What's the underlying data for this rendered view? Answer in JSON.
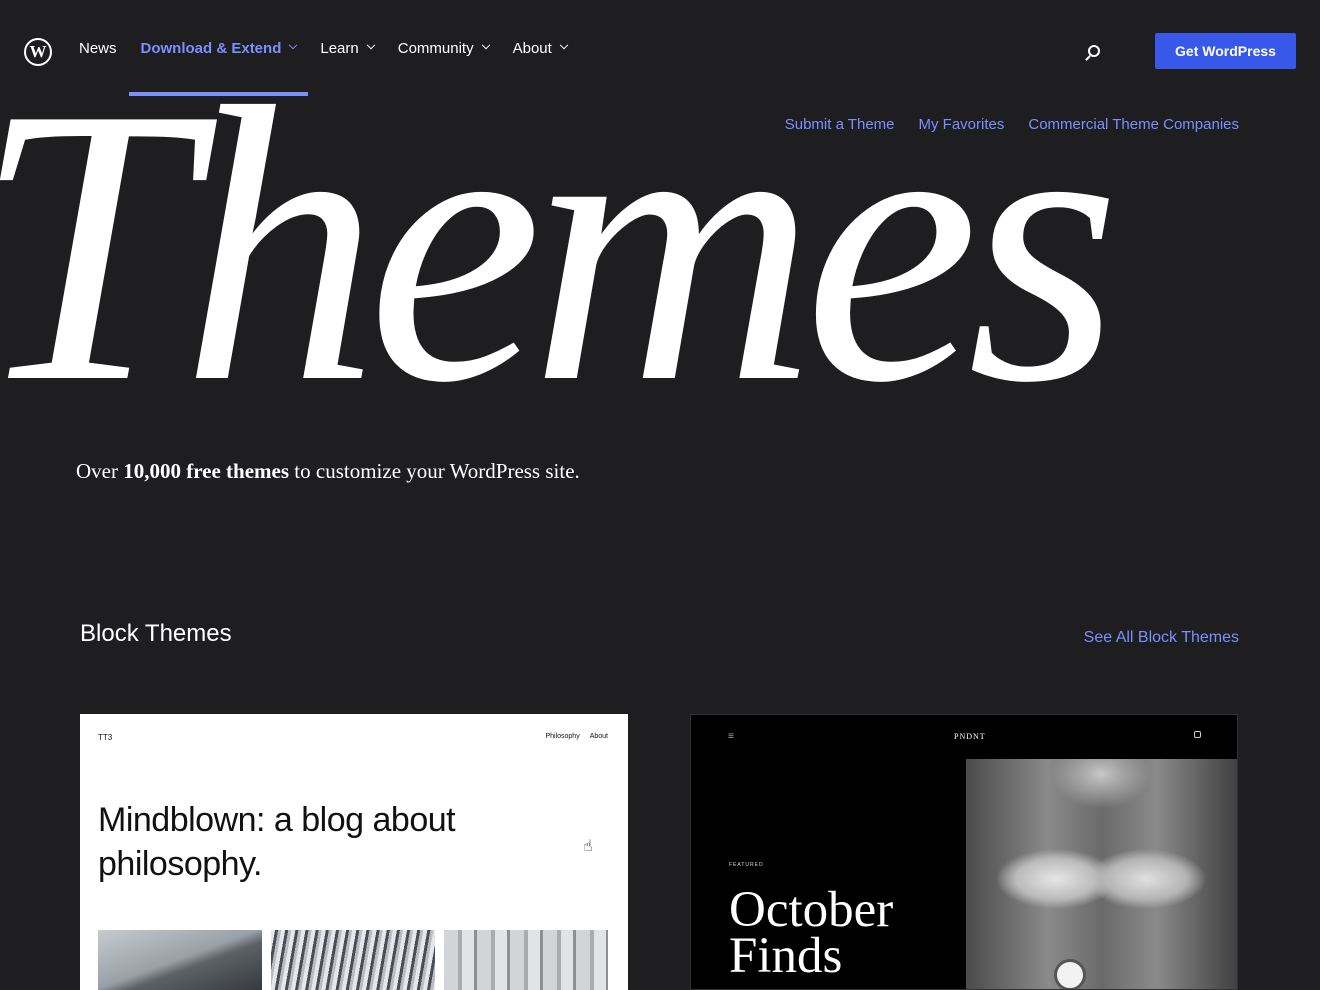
{
  "nav": {
    "logo_letter": "W",
    "items": [
      {
        "label": "News",
        "has_menu": false,
        "active": false
      },
      {
        "label": "Download & Extend",
        "has_menu": true,
        "active": true
      },
      {
        "label": "Learn",
        "has_menu": true,
        "active": false
      },
      {
        "label": "Community",
        "has_menu": true,
        "active": false
      },
      {
        "label": "About",
        "has_menu": true,
        "active": false
      }
    ],
    "cta_label": "Get WordPress",
    "accent_color": "#7b90ff",
    "cta_color": "#3858e9"
  },
  "hero": {
    "word": "Themes",
    "subnav": [
      "Submit a Theme",
      "My Favorites",
      "Commercial Theme Companies"
    ],
    "tagline_prefix": "Over ",
    "tagline_bold": "10,000 free themes",
    "tagline_suffix": " to customize your WordPress site."
  },
  "block_themes": {
    "title": "Block Themes",
    "see_all": "See All Block Themes",
    "cards": [
      {
        "brand": "TT3",
        "links": [
          "Philosophy",
          "About"
        ],
        "headline": "Mindblown: a blog about philosophy."
      },
      {
        "menu": "≡",
        "brand": "PNDNT",
        "featured": "FEATURED",
        "headline_line1": "October",
        "headline_line2": "Finds"
      }
    ]
  }
}
